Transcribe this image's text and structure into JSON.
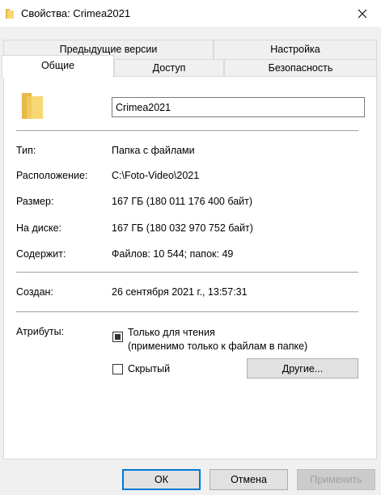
{
  "window": {
    "title": "Свойства: Crimea2021",
    "close_glyph": "✕"
  },
  "tabs": {
    "row_top": [
      {
        "label": "Предыдущие версии"
      },
      {
        "label": "Настройка"
      }
    ],
    "row_bottom": [
      {
        "label": "Общие",
        "active": true
      },
      {
        "label": "Доступ"
      },
      {
        "label": "Безопасность"
      }
    ]
  },
  "general": {
    "folder_name": "Crimea2021",
    "type": {
      "label": "Тип:",
      "value": "Папка с файлами"
    },
    "location": {
      "label": "Расположение:",
      "value": "C:\\Foto-Video\\2021"
    },
    "size": {
      "label": "Размер:",
      "value": "167 ГБ (180 011 176 400 байт)"
    },
    "on_disk": {
      "label": "На диске:",
      "value": "167 ГБ (180 032 970 752 байт)"
    },
    "contains": {
      "label": "Содержит:",
      "value": "Файлов: 10 544; папок: 49"
    },
    "created": {
      "label": "Создан:",
      "value": "26 сентября 2021 г., 13:57:31"
    },
    "attributes": {
      "label": "Атрибуты:",
      "readonly_label_line1": "Только для чтения",
      "readonly_label_line2": "(применимо только к файлам в папке)",
      "readonly_state": "indeterminate",
      "hidden_label": "Скрытый",
      "hidden_checked": false,
      "advanced_button": "Другие..."
    }
  },
  "footer": {
    "ok": "ОК",
    "cancel": "Отмена",
    "apply": "Применить"
  },
  "colors": {
    "folder": "#f8d775",
    "folder_dark": "#e8b84a",
    "accent": "#0078d7"
  }
}
